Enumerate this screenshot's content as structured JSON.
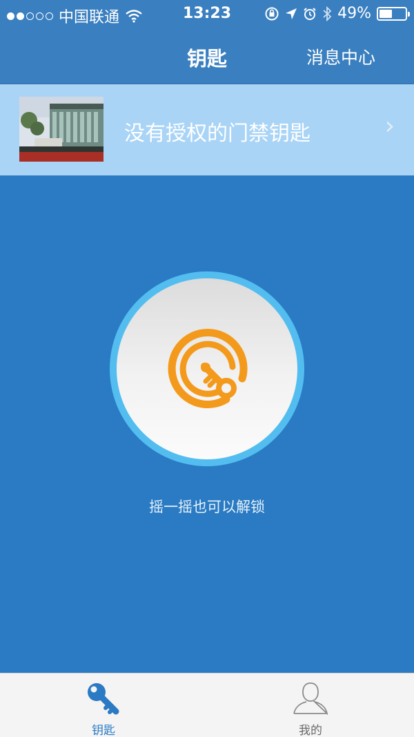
{
  "status_bar": {
    "carrier": "中国联通",
    "time": "13:23",
    "battery": "49%",
    "battery_level": 0.49,
    "icons": [
      "signal-icon",
      "wifi-icon",
      "orientation-lock-icon",
      "location-icon",
      "alarm-icon",
      "bluetooth-icon",
      "battery-icon"
    ]
  },
  "nav": {
    "title": "钥匙",
    "right_label": "消息中心"
  },
  "banner": {
    "label": "没有授权的门禁钥匙",
    "image": "building-photo",
    "chevron": "›"
  },
  "unlock": {
    "icon": "key-icon",
    "hint": "摇一摇也可以解锁"
  },
  "tabs": [
    {
      "label": "钥匙",
      "icon": "key-icon",
      "active": true
    },
    {
      "label": "我的",
      "icon": "person-icon",
      "active": false
    }
  ],
  "colors": {
    "background": "#2a7bc3",
    "nav": "#3a7fc0",
    "banner": "#a9d4f6",
    "ring": "#53bdf0",
    "key_orange": "#f39a1c",
    "tab_active": "#2a7bc3",
    "tab_inactive": "#6a6a6a"
  }
}
